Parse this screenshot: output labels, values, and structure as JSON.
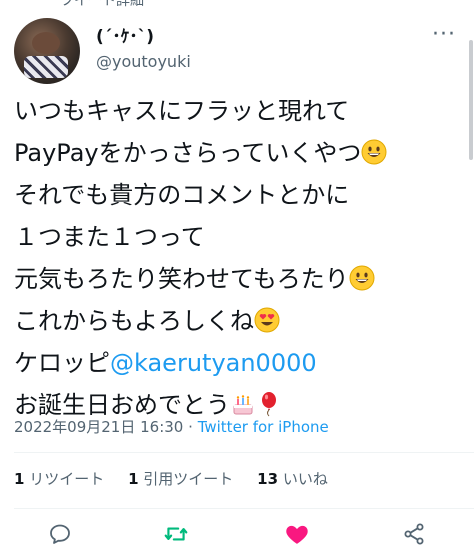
{
  "tweet": {
    "top_cut_text": "ツイート詳細",
    "author": {
      "display_name": "(´･ｹ･`)",
      "handle": "@youtoyuki"
    },
    "more_icon": "more-dots-icon",
    "lines": [
      {
        "text": "いつもキャスにフラッと現れて"
      },
      {
        "text": "PayPayをかっさらっていくやつ",
        "emoji": "grinning-face"
      },
      {
        "text": "それでも貴方のコメントとかに"
      },
      {
        "text": "１つまた１つって"
      },
      {
        "text": "元気もろたり笑わせてもろたり",
        "emoji": "grinning-face"
      },
      {
        "text": "これからもよろしくね",
        "emoji": "heart-eyes-face"
      },
      {
        "prefix": "ケロッピ",
        "mention": "@kaerutyan0000"
      },
      {
        "text": "お誕生日おめでとう",
        "emoji": "birthday-cake",
        "emoji2": "balloon"
      }
    ],
    "timestamp": "2022年09月21日 16:30",
    "separator": "·",
    "source": "Twitter for iPhone",
    "stats": {
      "retweets_count": "1",
      "retweets_label": "リツイート",
      "quotes_count": "1",
      "quotes_label": "引用ツイート",
      "likes_count": "13",
      "likes_label": "いいね"
    },
    "actions": [
      "reply-icon",
      "retweet-icon",
      "like-icon",
      "share-icon"
    ],
    "colors": {
      "accent": "#1d9bf0",
      "retweet": "#00ba7c",
      "like": "#f91880",
      "muted": "#536471"
    }
  }
}
